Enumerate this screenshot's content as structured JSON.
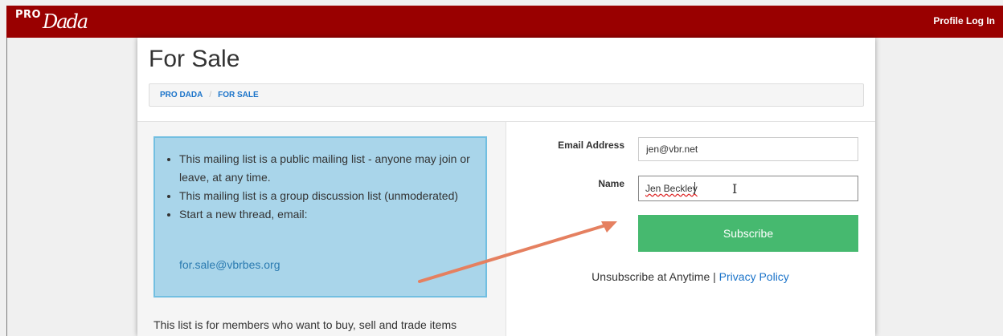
{
  "header": {
    "logo_pro": "PRO",
    "logo_dada": "Dada",
    "profile_login": "Profile Log In",
    "bg_color": "#990000"
  },
  "page": {
    "title": "For Sale",
    "breadcrumb": [
      "PRO DADA",
      "FOR SALE"
    ],
    "breadcrumb_sep": "/"
  },
  "info": {
    "items": [
      "This mailing list is a public mailing list - anyone may join or leave, at any time.",
      "This mailing list is a group discussion list (unmoderated)",
      "Start a new thread, email:"
    ],
    "email": "for.sale@vbrbes.org",
    "description": "This list is for members who want to buy, sell and trade items"
  },
  "form": {
    "email_label": "Email Address",
    "email_value": "jen@vbr.net",
    "name_label": "Name",
    "name_value": "Jen Beckley",
    "subscribe_label": "Subscribe",
    "unsubscribe_text": "Unsubscribe at Anytime",
    "separator": "|",
    "privacy_label": "Privacy Policy",
    "subscribe_color": "#46b96f"
  }
}
